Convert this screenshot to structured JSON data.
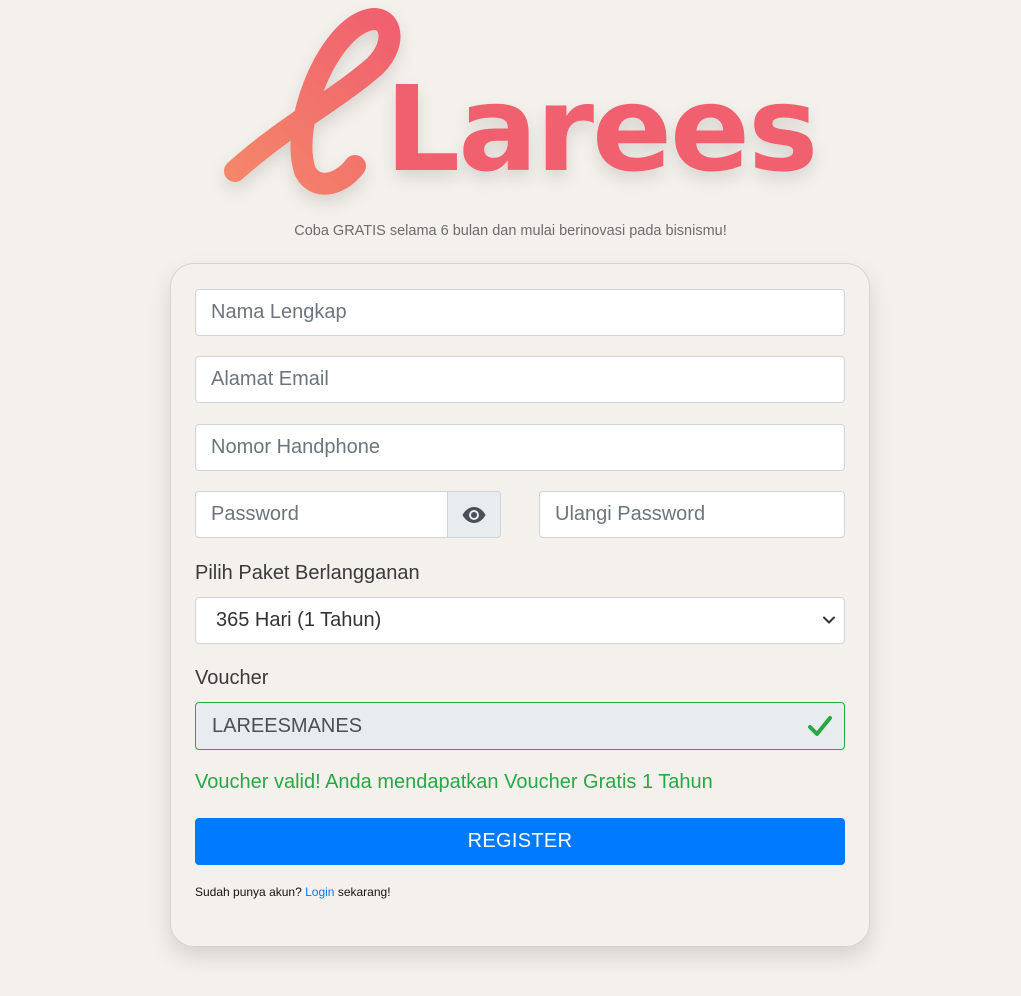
{
  "brand": {
    "logo_text": "Larees",
    "logo_initial": "e",
    "color": "#f0606e"
  },
  "tagline": "Coba GRATIS selama 6 bulan dan mulai berinovasi pada bisnismu!",
  "form": {
    "full_name": {
      "placeholder": "Nama Lengkap",
      "value": ""
    },
    "email": {
      "placeholder": "Alamat Email",
      "value": ""
    },
    "phone": {
      "placeholder": "Nomor Handphone",
      "value": ""
    },
    "password": {
      "placeholder": "Password",
      "value": "",
      "toggle_icon": "eye-icon"
    },
    "confirm_password": {
      "placeholder": "Ulangi Password",
      "value": ""
    },
    "package": {
      "label": "Pilih Paket Berlangganan",
      "selected": "365 Hari (1 Tahun)"
    },
    "voucher": {
      "label": "Voucher",
      "value": "LAREESMANES",
      "status_icon": "check-icon",
      "status_color": "#28a745",
      "message": "Voucher valid! Anda mendapatkan Voucher Gratis 1 Tahun"
    },
    "submit_label": "REGISTER",
    "submit_color": "#007bff"
  },
  "footer": {
    "prefix": "Sudah punya akun?",
    "link": "Login",
    "suffix": "sekarang!"
  }
}
